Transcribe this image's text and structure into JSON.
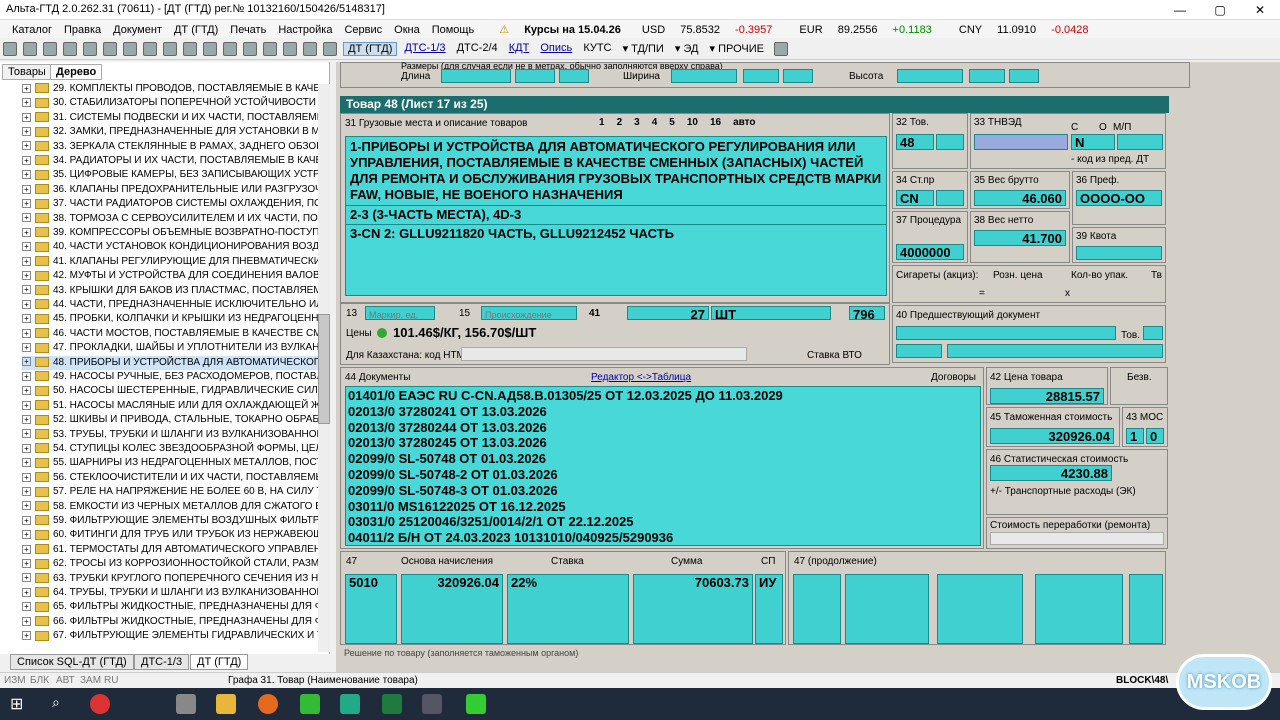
{
  "window": {
    "title": "Альта-ГТД 2.0.262.31 (70611) - [ДТ (ГТД) рег.№ 10132160/150426/5148317]"
  },
  "menu": [
    "Каталог",
    "Правка",
    "Документ",
    "ДТ (ГТД)",
    "Печать",
    "Настройка",
    "Сервис",
    "Окна",
    "Помощь"
  ],
  "rates": {
    "label": "Курсы на",
    "date": "15.04.26",
    "usd": "USD",
    "usd_val": "75.8532",
    "usd_chg": "-0.3957",
    "eur": "EUR",
    "eur_val": "89.2556",
    "eur_chg": "+0.1183",
    "cny": "CNY",
    "cny_val": "11.0910",
    "cny_chg": "-0.0428"
  },
  "toolbar": {
    "dt": "ДТ (ГТД)",
    "dts13": "ДТС-1/3",
    "dts24": "ДТС-2/4",
    "kdt": "КДТ",
    "opis": "Опись",
    "kuts": "КУТС",
    "tdpi": "ТД/ПИ",
    "ed": "ЭД",
    "other": "ПРОЧИЕ"
  },
  "left": {
    "tab_goods": "Товары",
    "tab_tree": "Дерево"
  },
  "tree": [
    "29. КОМПЛЕКТЫ ПРОВОДОВ, ПОСТАВЛЯЕМЫЕ В КАЧЕСТВЕ",
    "30. СТАБИЛИЗАТОРЫ ПОПЕРЕЧНОЙ УСТОЙЧИВОСТИ И ИХ",
    "31. СИСТЕМЫ ПОДВЕСКИ И ИХ ЧАСТИ, ПОСТАВЛЯЕМЫЕ В",
    "32. ЗАМКИ, ПРЕДНАЗНАЧЕННЫЕ ДЛЯ УСТАНОВКИ В МОТ",
    "33. ЗЕРКАЛА СТЕКЛЯННЫЕ В РАМАХ, ЗАДНЕГО ОБЗОРА, Г",
    "34. РАДИАТОРЫ И ИХ ЧАСТИ, ПОСТАВЛЯЕМЫЕ В КАЧЕСТ",
    "35. ЦИФРОВЫЕ КАМЕРЫ, БЕЗ ЗАПИСЫВАЮЩИХ УСТРОЙС",
    "36. КЛАПАНЫ ПРЕДОХРАНИТЕЛЬНЫЕ ИЛИ РАЗГРУЗОЧНЫЕ",
    "37. ЧАСТИ РАДИАТОРОВ СИСТЕМЫ ОХЛАЖДЕНИЯ, ПОСТА",
    "38. ТОРМОЗА С СЕРВОУСИЛИТЕЛЕМ И ИХ ЧАСТИ, ПОСТАВ",
    "39. КОМПРЕССОРЫ ОБЪЕМНЫЕ ВОЗВРАТНО-ПОСТУПАТЕЛ",
    "40. ЧАСТИ УСТАНОВОК КОНДИЦИОНИРОВАНИЯ ВОЗДУХА",
    "41. КЛАПАНЫ РЕГУЛИРУЮЩИЕ ДЛЯ ПНЕВМАТИЧЕСКИХ С",
    "42. МУФТЫ И УСТРОЙСТВА ДЛЯ СОЕДИНЕНИЯ ВАЛОВ, С",
    "43. КРЫШКИ ДЛЯ БАКОВ ИЗ ПЛАСТМАС, ПОСТАВЛЯЕМЫЕ",
    "44. ЧАСТИ, ПРЕДНАЗНАЧЕННЫЕ ИСКЛЮЧИТЕЛЬНО ИЛИ Е",
    "45. ПРОБКИ, КОЛПАЧКИ И КРЫШКИ ИЗ НЕДРАГОЦЕННЫХ",
    "46. ЧАСТИ МОСТОВ, ПОСТАВЛЯЕМЫЕ В КАЧЕСТВЕ СМЕНН",
    "47. ПРОКЛАДКИ, ШАЙБЫ И УПЛОТНИТЕЛИ ИЗ ВУЛКАНИЗ",
    "48. ПРИБОРЫ И УСТРОЙСТВА ДЛЯ АВТОМАТИЧЕСКОГО Р",
    "49. НАСОСЫ РУЧНЫЕ, БЕЗ РАСХОДОМЕРОВ, ПОСТАВЛЯЕМ",
    "50. НАСОСЫ ШЕСТЕРЕННЫЕ, ГИДРАВЛИЧЕСКИЕ СИЛОВЫ",
    "51. НАСОСЫ МАСЛЯНЫЕ ИЛИ ДЛЯ ОХЛАЖДАЮЩЕЙ ЖИД",
    "52. ШКИВЫ И ПРИВОДА, СТАЛЬНЫЕ, ТОКАРНО ОБРАБОТА",
    "53. ТРУБЫ, ТРУБКИ И ШЛАНГИ ИЗ ВУЛКАНИЗОВАННОЙ Р",
    "54. СТУПИЦЫ КОЛЕС ЗВЕЗДООБРАЗНОЙ ФОРМЫ, ЦЕЛЬН",
    "55. ШАРНИРЫ ИЗ НЕДРАГОЦЕННЫХ МЕТАЛЛОВ, ПОСТАВ",
    "56. СТЕКЛООЧИСТИТЕЛИ И ИХ ЧАСТИ, ПОСТАВЛЯЕМЫЕ В",
    "57. РЕЛЕ НА НАПРЯЖЕНИЕ НЕ БОЛЕЕ 60 В, НА СИЛУ ТОК",
    "58. ЕМКОСТИ ИЗ ЧЕРНЫХ МЕТАЛЛОВ ДЛЯ СЖАТОГО ВОЗ",
    "59. ФИЛЬТРУЮЩИЕ ЭЛЕМЕНТЫ ВОЗДУШНЫХ ФИЛЬТРОВ",
    "60. ФИТИНГИ ДЛЯ ТРУБ ИЛИ ТРУБОК ИЗ НЕРЖАВЕЮЩЕЙ",
    "61. ТЕРМОСТАТЫ ДЛЯ АВТОМАТИЧЕСКОГО УПРАВЛЕНИЯ",
    "62. ТРОСЫ ИЗ КОРРОЗИОННОСТОЙКОЙ СТАЛИ, РАЗМЕРО",
    "63. ТРУБКИ КРУГЛОГО ПОПЕРЕЧНОГО СЕЧЕНИЯ ИЗ НЕДР",
    "64. ТРУБЫ, ТРУБКИ И ШЛАНГИ ИЗ ВУЛКАНИЗОВАННОЙ",
    "65. ФИЛЬТРЫ ЖИДКОСТНЫЕ, ПРЕДНАЗНАЧЕНЫ ДЛЯ ФИ",
    "66. ФИЛЬТРЫ ЖИДКОСТНЫЕ, ПРЕДНАЗНАЧЕНЫ ДЛЯ ФИ",
    "67. ФИЛЬТРУЮЩИЕ ЭЛЕМЕНТЫ ГИДРАВЛИЧЕСКИХ И ТОГ"
  ],
  "tree_selected": 19,
  "bottomtabs": [
    "Список SQL-ДТ (ГТД)",
    "ДТС-1/3",
    "ДТ (ГТД)"
  ],
  "status": {
    "izm": "ИЗМ",
    "blk": "БЛК",
    "avt": "АВТ",
    "zam": "ЗАМ",
    "ru": "RU",
    "text": "Графа 31. Товар (Наименование товара)",
    "block": "BLOCK\\48\\"
  },
  "top": {
    "dims": "Размеры (для случая если не в метрах, обычно заполняются вверху справа)",
    "length": "Длина",
    "width": "Ширина",
    "height": "Высота"
  },
  "goods": {
    "header": "Товар 48 (Лист 17 из 25)",
    "g31": "31 Грузовые места и описание товаров",
    "tabs": [
      "1",
      "2",
      "3",
      "4",
      "5",
      "10",
      "16",
      "авто"
    ],
    "desc1": "1-ПРИБОРЫ И УСТРОЙСТВА ДЛЯ АВТОМАТИЧЕСКОГО РЕГУЛИРОВАНИЯ ИЛИ УПРАВЛЕНИЯ, ПОСТАВЛЯЕМЫЕ В КАЧЕСТВЕ СМЕННЫХ (ЗАПАСНЫХ) ЧАСТЕЙ ДЛЯ РЕМОНТА И ОБСЛУЖИВАНИЯ ГРУЗОВЫХ ТРАНСПОРТНЫХ СРЕДСТВ МАРКИ FAW, НОВЫЕ, НЕ ВОЕНОГО НАЗНАЧЕНИЯ",
    "desc2": "2-3 (3-ЧАСТЬ МЕСТА), 4D-3",
    "desc3": "3-CN 2: GLLU9211820 ЧАСТЬ, GLLU9212452 ЧАСТЬ",
    "g13": "13",
    "mark_ph": "Маркир. ед.",
    "g15": "15",
    "prod_ph": "Происхождение",
    "g41": "41",
    "qty": "27",
    "unit": "ШТ",
    "unitcode": "796",
    "price_lbl": "Цены",
    "price": "101.46$/КГ, 156.70$/ШТ",
    "kz": "Для Казахстана: код НТМ",
    "vto": "Ставка ВТО"
  },
  "right": {
    "g32": "32 Тов.",
    "g32v": "48",
    "g33": "33 ТНВЭД",
    "g33c": "С",
    "g33o": "О",
    "g33ml": "М/П",
    "g33n": "N",
    "g33hint": "- код из пред. ДТ",
    "g34": "34 Ст.пр",
    "g34v": "CN",
    "g35": "35 Вес брутто",
    "g35v": "46.060",
    "g36": "36 Преф.",
    "g36v": "ОООО-ОО",
    "g37": "37 Процедура",
    "g37v": "4000000",
    "g38": "38 Вес нетто",
    "g38v": "41.700",
    "g39": "39 Квота",
    "cig": "Сигареты (акциз):",
    "rozn": "Розн. цена",
    "kol": "Кол-во упак.",
    "tv": "Тв",
    "eq": "=",
    "x": "x",
    "g40": "40 Предшествующий документ",
    "tov": "Тов."
  },
  "docs": {
    "g44": "44 Документы",
    "editor": "Редактор <->Таблица",
    "dog": "Договоры",
    "rows": [
      "01401/0 ЕАЭС RU C-CN.АД58.В.01305/25 ОТ 12.03.2025 ДО 11.03.2029",
      "02013/0 37280241 ОТ 13.03.2026",
      "02013/0 37280244 ОТ 13.03.2026",
      "02013/0 37280245 ОТ 13.03.2026",
      "02099/0 SL-50748 ОТ 01.03.2026",
      "02099/0 SL-50748-2 ОТ 01.03.2026",
      "02099/0 SL-50748-3 ОТ 01.03.2026",
      "03011/0 MS16122025 ОТ 16.12.2025",
      "03031/0 25120046/3251/0014/2/1 ОТ 22.12.2025",
      "04011/2 Б/Н ОТ 24.03.2023 10131010/040925/5290936"
    ]
  },
  "cost": {
    "g42": "42 Цена товара",
    "g42v": "28815.57",
    "bezv": "Безв.",
    "g45": "45 Таможенная стоимость",
    "g45v": "320926.04",
    "g43": "43 МОС",
    "g43a": "1",
    "g43b": "0",
    "g46": "46 Статистическая стоимость",
    "g46v": "4230.88",
    "transp": "+/- Транспортные расходы (ЭК)",
    "proc": "Стоимость переработки (ремонта)"
  },
  "g47": {
    "label": "47",
    "base": "Основа начисления",
    "rate": "Ставка",
    "sum": "Сумма",
    "sp": "СП",
    "code": "5010",
    "basev": "320926.04",
    "ratev": "22%",
    "sumv": "70603.73",
    "spv": "ИУ",
    "cont": "47 (продолжение)",
    "foot": "Решение по товару (заполняется таможенным органом)"
  },
  "watermark": "MSKOB"
}
